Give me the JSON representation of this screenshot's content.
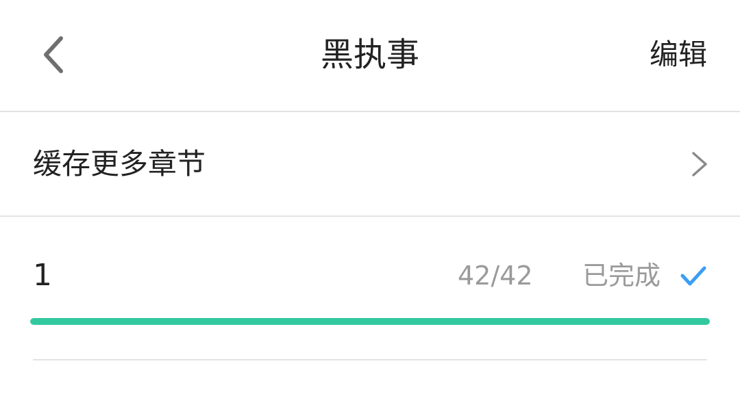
{
  "header": {
    "title": "黑执事",
    "edit_label": "编辑",
    "back_icon": "chevron-left-icon"
  },
  "cache_more": {
    "label": "缓存更多章节",
    "icon": "chevron-right-icon"
  },
  "downloads": [
    {
      "name": "1",
      "count": "42/42",
      "status": "已完成",
      "status_icon": "check-icon",
      "progress": 1.0
    }
  ],
  "colors": {
    "accent_check": "#3b9ef5",
    "progress": "#33c9a0"
  }
}
